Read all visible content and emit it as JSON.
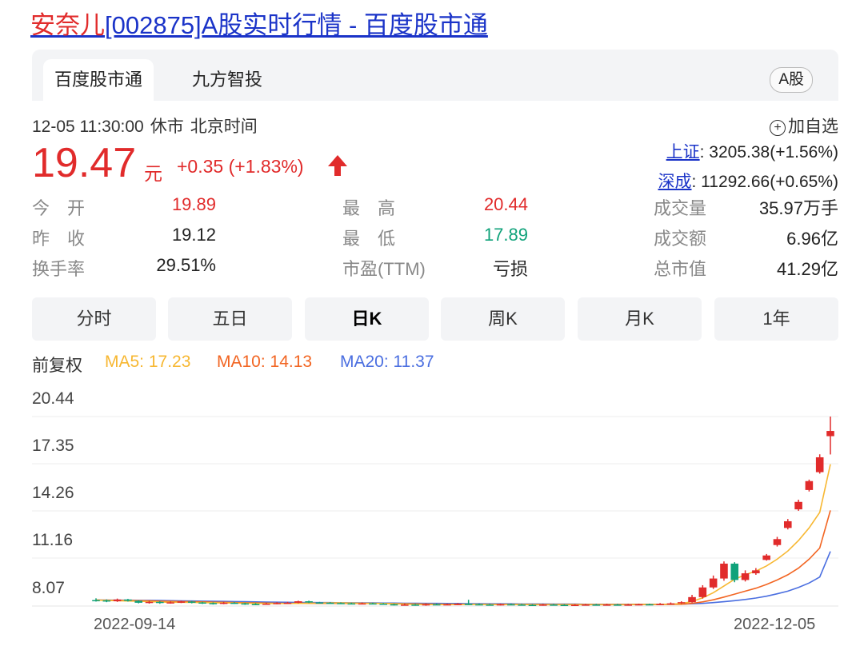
{
  "title": {
    "name": "安奈儿",
    "rest": "[002875]A股实时行情 - 百度股市通"
  },
  "tabs": [
    {
      "label": "百度股市通"
    },
    {
      "label": "九方智投"
    }
  ],
  "market_badge": "A股",
  "meta": {
    "time": "12-05 11:30:00",
    "status": "休市",
    "zone": "北京时间"
  },
  "add_watch": "加自选",
  "quote": {
    "price": "19.47",
    "unit": "元",
    "change": "+0.35 (+1.83%)"
  },
  "indices": [
    {
      "name": "上证",
      "value": ": 3205.38(+1.56%)"
    },
    {
      "name": "深成",
      "value": ": 11292.66(+0.65%)"
    }
  ],
  "stats": {
    "col1": [
      {
        "label": "今　开",
        "value": "19.89",
        "color": "red"
      },
      {
        "label": "昨　收",
        "value": "19.12",
        "color": "normal"
      },
      {
        "label": "换手率",
        "value": "29.51%",
        "color": "normal"
      }
    ],
    "col2": [
      {
        "label": "最　高",
        "value": "20.44",
        "color": "red"
      },
      {
        "label": "最　低",
        "value": "17.89",
        "color": "green"
      },
      {
        "label": "市盈(TTM)",
        "value": "亏损",
        "color": "normal"
      }
    ],
    "col3": [
      {
        "label": "成交量",
        "value": "35.97万手",
        "color": "normal"
      },
      {
        "label": "成交额",
        "value": "6.96亿",
        "color": "normal"
      },
      {
        "label": "总市值",
        "value": "41.29亿",
        "color": "normal"
      }
    ]
  },
  "period_tabs": [
    {
      "label": "分时"
    },
    {
      "label": "五日"
    },
    {
      "label": "日K"
    },
    {
      "label": "周K"
    },
    {
      "label": "月K"
    },
    {
      "label": "1年"
    }
  ],
  "active_period": 2,
  "colors": {
    "up": "#e12b2b",
    "down": "#0fa27a",
    "ma5": "#f7b731",
    "ma10": "#f26522",
    "ma20": "#4a6ee0"
  },
  "chart_data": {
    "type": "candlestick",
    "adjust_label": "前复权",
    "ma_legend": [
      {
        "name": "MA5",
        "text": "MA5: 17.23"
      },
      {
        "name": "MA10",
        "text": "MA10: 14.13"
      },
      {
        "name": "MA20",
        "text": "MA20: 11.37"
      }
    ],
    "y_ticks": [
      "20.44",
      "17.35",
      "14.26",
      "11.16",
      "8.07"
    ],
    "x_ticks": [
      "2022-09-14",
      "2022-12-05"
    ],
    "ylim": [
      7.7,
      20.44
    ],
    "candles": [
      [
        8.1,
        8.08,
        8.22,
        8.0
      ],
      [
        8.08,
        8.02,
        8.14,
        7.96
      ],
      [
        8.02,
        8.14,
        8.2,
        7.98
      ],
      [
        8.14,
        8.05,
        8.18,
        8.0
      ],
      [
        8.05,
        7.92,
        8.08,
        7.88
      ],
      [
        7.92,
        7.98,
        8.04,
        7.86
      ],
      [
        7.98,
        7.9,
        8.02,
        7.85
      ],
      [
        7.9,
        7.95,
        8.0,
        7.86
      ],
      [
        7.95,
        8.0,
        8.06,
        7.9
      ],
      [
        8.0,
        7.94,
        8.04,
        7.88
      ],
      [
        7.94,
        7.9,
        7.98,
        7.84
      ],
      [
        7.9,
        7.86,
        7.94,
        7.8
      ],
      [
        7.86,
        7.92,
        7.98,
        7.82
      ],
      [
        7.92,
        7.88,
        7.96,
        7.84
      ],
      [
        7.88,
        7.84,
        7.92,
        7.78
      ],
      [
        7.84,
        7.82,
        7.9,
        7.76
      ],
      [
        7.82,
        7.86,
        7.92,
        7.78
      ],
      [
        7.86,
        7.9,
        7.96,
        7.82
      ],
      [
        7.9,
        7.92,
        7.98,
        7.86
      ],
      [
        7.92,
        8.02,
        8.06,
        7.88
      ],
      [
        8.02,
        7.94,
        8.06,
        7.9
      ],
      [
        7.94,
        7.92,
        7.98,
        7.88
      ],
      [
        7.92,
        7.9,
        7.96,
        7.86
      ],
      [
        7.9,
        7.88,
        7.94,
        7.84
      ],
      [
        7.88,
        7.86,
        7.92,
        7.82
      ],
      [
        7.86,
        7.88,
        7.94,
        7.82
      ],
      [
        7.88,
        7.86,
        7.92,
        7.82
      ],
      [
        7.86,
        7.82,
        7.9,
        7.78
      ],
      [
        7.82,
        7.78,
        7.86,
        7.74
      ],
      [
        7.78,
        7.8,
        7.86,
        7.74
      ],
      [
        7.8,
        7.76,
        7.84,
        7.72
      ],
      [
        7.76,
        7.82,
        7.88,
        7.72
      ],
      [
        7.82,
        7.8,
        7.86,
        7.76
      ],
      [
        7.8,
        7.82,
        7.86,
        7.76
      ],
      [
        7.82,
        7.84,
        7.9,
        7.78
      ],
      [
        7.84,
        7.82,
        8.12,
        7.78
      ],
      [
        7.82,
        7.8,
        7.86,
        7.76
      ],
      [
        7.8,
        7.78,
        7.84,
        7.74
      ],
      [
        7.78,
        7.82,
        7.86,
        7.74
      ],
      [
        7.82,
        7.8,
        7.86,
        7.76
      ],
      [
        7.8,
        7.78,
        7.84,
        7.74
      ],
      [
        7.78,
        7.76,
        7.82,
        7.72
      ],
      [
        7.76,
        7.8,
        7.84,
        7.72
      ],
      [
        7.8,
        7.78,
        7.84,
        7.74
      ],
      [
        7.78,
        7.76,
        7.82,
        7.72
      ],
      [
        7.76,
        7.78,
        7.82,
        7.72
      ],
      [
        7.78,
        7.8,
        7.84,
        7.74
      ],
      [
        7.8,
        7.78,
        7.84,
        7.74
      ],
      [
        7.78,
        7.8,
        7.86,
        7.74
      ],
      [
        7.8,
        7.78,
        7.84,
        7.74
      ],
      [
        7.78,
        7.8,
        7.84,
        7.74
      ],
      [
        7.8,
        7.82,
        7.86,
        7.76
      ],
      [
        7.82,
        7.8,
        7.86,
        7.76
      ],
      [
        7.8,
        7.84,
        7.9,
        7.76
      ],
      [
        7.84,
        7.88,
        7.94,
        7.8
      ],
      [
        7.88,
        7.96,
        8.02,
        7.84
      ],
      [
        7.96,
        8.3,
        8.45,
        7.92
      ],
      [
        8.3,
        8.95,
        9.1,
        8.2
      ],
      [
        8.95,
        9.55,
        9.75,
        8.85
      ],
      [
        9.55,
        10.55,
        10.7,
        9.4
      ],
      [
        10.55,
        9.45,
        10.65,
        9.3
      ],
      [
        9.45,
        9.9,
        10.1,
        9.35
      ],
      [
        9.9,
        10.1,
        10.25,
        9.8
      ],
      [
        10.8,
        11.1,
        11.2,
        10.75
      ],
      [
        11.8,
        12.2,
        12.35,
        11.7
      ],
      [
        12.95,
        13.4,
        13.55,
        12.85
      ],
      [
        14.2,
        14.7,
        14.85,
        14.1
      ],
      [
        15.5,
        16.1,
        16.2,
        15.4
      ],
      [
        16.7,
        17.7,
        17.9,
        16.6
      ],
      [
        19.12,
        19.47,
        20.44,
        17.89
      ]
    ],
    "ma5": [
      8.1,
      8.08,
      8.06,
      8.04,
      8.02,
      8.0,
      7.97,
      7.95,
      7.95,
      7.94,
      7.93,
      7.92,
      7.91,
      7.9,
      7.89,
      7.88,
      7.87,
      7.87,
      7.87,
      7.88,
      7.89,
      7.9,
      7.91,
      7.91,
      7.9,
      7.89,
      7.88,
      7.87,
      7.85,
      7.83,
      7.81,
      7.8,
      7.8,
      7.8,
      7.81,
      7.82,
      7.82,
      7.81,
      7.8,
      7.8,
      7.8,
      7.79,
      7.79,
      7.79,
      7.79,
      7.79,
      7.79,
      7.79,
      7.79,
      7.79,
      7.79,
      7.8,
      7.8,
      7.81,
      7.83,
      7.86,
      8.0,
      8.25,
      8.6,
      9.05,
      9.5,
      9.8,
      10.05,
      10.4,
      10.85,
      11.4,
      12.1,
      12.95,
      14.0,
      17.23
    ],
    "ma10": [
      8.1,
      8.09,
      8.08,
      8.07,
      8.06,
      8.05,
      8.03,
      8.01,
      8.0,
      7.99,
      7.98,
      7.96,
      7.95,
      7.93,
      7.92,
      7.91,
      7.9,
      7.89,
      7.88,
      7.88,
      7.88,
      7.88,
      7.88,
      7.88,
      7.88,
      7.88,
      7.88,
      7.87,
      7.86,
      7.85,
      7.84,
      7.83,
      7.82,
      7.82,
      7.82,
      7.82,
      7.81,
      7.81,
      7.81,
      7.81,
      7.81,
      7.8,
      7.8,
      7.8,
      7.8,
      7.8,
      7.8,
      7.8,
      7.8,
      7.8,
      7.8,
      7.8,
      7.8,
      7.8,
      7.81,
      7.82,
      7.88,
      7.98,
      8.12,
      8.3,
      8.5,
      8.7,
      8.9,
      9.15,
      9.45,
      9.8,
      10.25,
      10.85,
      11.6,
      14.13
    ],
    "ma20": [
      8.1,
      8.1,
      8.09,
      8.09,
      8.08,
      8.08,
      8.07,
      8.06,
      8.05,
      8.04,
      8.03,
      8.02,
      8.01,
      8.0,
      7.99,
      7.98,
      7.97,
      7.96,
      7.95,
      7.94,
      7.94,
      7.93,
      7.93,
      7.92,
      7.92,
      7.91,
      7.91,
      7.9,
      7.9,
      7.89,
      7.89,
      7.88,
      7.88,
      7.87,
      7.87,
      7.86,
      7.86,
      7.85,
      7.85,
      7.85,
      7.84,
      7.84,
      7.84,
      7.83,
      7.83,
      7.83,
      7.82,
      7.82,
      7.82,
      7.82,
      7.82,
      7.82,
      7.82,
      7.82,
      7.82,
      7.83,
      7.85,
      7.88,
      7.93,
      7.99,
      8.06,
      8.14,
      8.24,
      8.36,
      8.52,
      8.7,
      8.95,
      9.25,
      9.65,
      11.37
    ]
  }
}
